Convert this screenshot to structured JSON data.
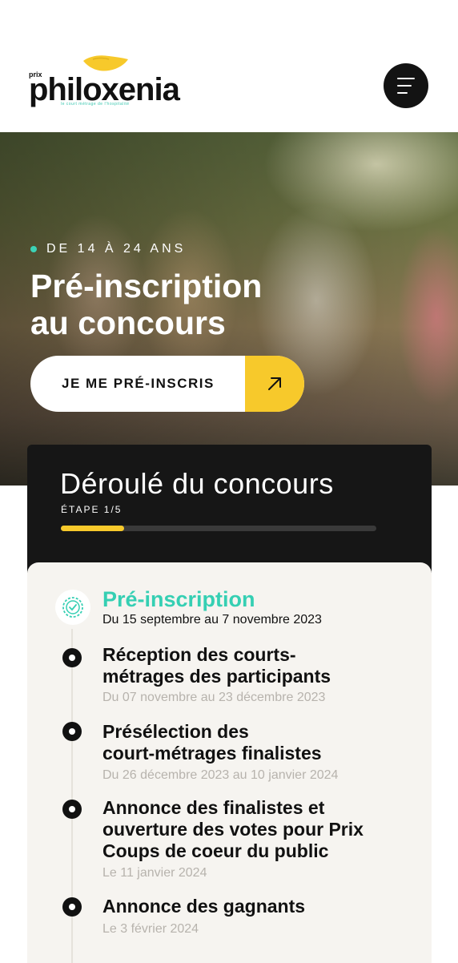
{
  "header": {
    "logo_prefix": "prix",
    "logo_name": "philoxenia",
    "logo_tagline": "le court métrage de l'hospitalité"
  },
  "hero": {
    "kicker": "DE 14 À 24 ANS",
    "title_line1": "Pré-inscription",
    "title_line2": "au concours",
    "cta_label": "JE ME PRÉ-INSCRIS"
  },
  "timeline": {
    "title": "Déroulé du concours",
    "step_label": "ÉTAPE 1/5",
    "progress": 0.2,
    "steps": [
      {
        "title": "Pré-inscription",
        "date": "Du 15 septembre au 7 novembre 2023"
      },
      {
        "title_line1": "Réception des courts-",
        "title_line2": "métrages des participants",
        "date": "Du 07 novembre au 23 décembre 2023"
      },
      {
        "title_line1": "Présélection des",
        "title_line2": "court-métrages finalistes",
        "date": "Du 26 décembre 2023 au 10 janvier 2024"
      },
      {
        "title_line1": "Annonce des finalistes et",
        "title_line2": "ouverture des votes pour Prix",
        "title_line3": "Coups de coeur du public",
        "date": "Le 11 janvier 2024"
      },
      {
        "title": "Annonce des gagnants",
        "date": "Le 3 février 2024"
      }
    ]
  },
  "colors": {
    "accent_yellow": "#f7c92b",
    "accent_teal": "#35cfb3",
    "dark": "#161616"
  }
}
